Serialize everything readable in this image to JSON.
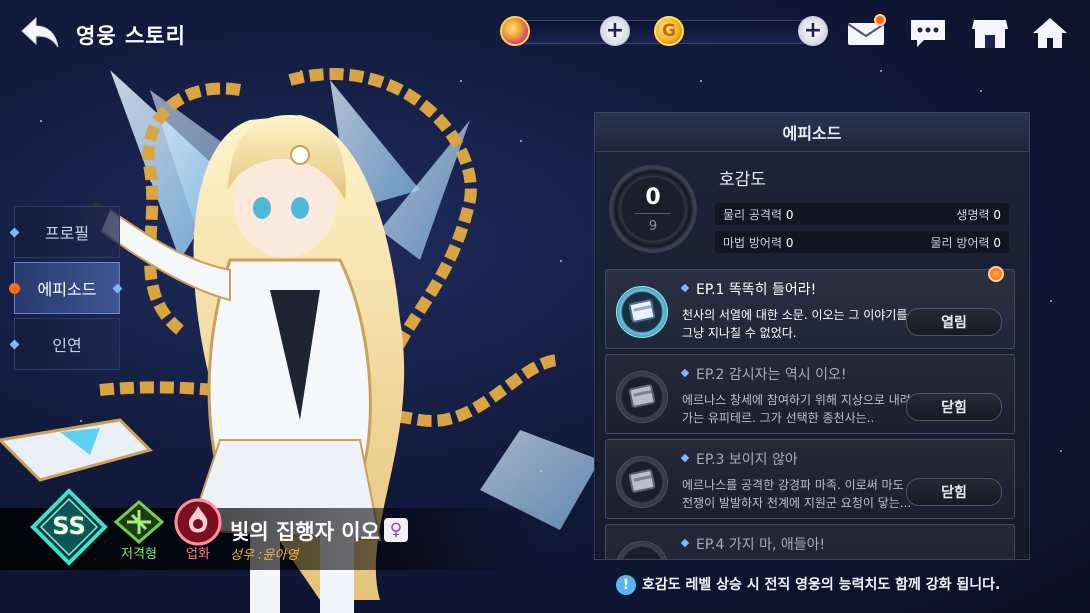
{
  "header": {
    "title": "영웅 스토리",
    "gold_symbol": "G"
  },
  "side_tabs": [
    {
      "label": "프로필",
      "active": false
    },
    {
      "label": "에피소드",
      "active": true
    },
    {
      "label": "인연",
      "active": false
    }
  ],
  "hero": {
    "rank": "SS",
    "class_label": "저격형",
    "element_label": "업화",
    "name": "빛의 집행자 이오",
    "gender_symbol": "♀",
    "cv": "성우 :윤아영"
  },
  "panel": {
    "title": "에피소드",
    "affinity": {
      "label": "호감도",
      "level": "0",
      "max": "9"
    },
    "stats": [
      {
        "label": "물리 공격력",
        "value": "0"
      },
      {
        "label": "생명력",
        "value": "0"
      },
      {
        "label": "마법 방어력",
        "value": "0"
      },
      {
        "label": "물리 방어력",
        "value": "0"
      }
    ],
    "episodes": [
      {
        "title": "EP.1 똑똑히 들어라!",
        "desc": "천사의 서열에 대한 소문. 이오는 그 이야기를 그냥 지나칠 수 없었다.",
        "button": "열림",
        "state": "open"
      },
      {
        "title": "EP.2 감시자는 역시 이오!",
        "desc": "에르나스 창세에 참여하기 위해 지상으로 내려가는 유피테르. 그가 선택한 종천사는..",
        "button": "닫힘",
        "state": "locked"
      },
      {
        "title": "EP.3 보이지 않아",
        "desc": "에르나스를 공격한 강경파 마족. 이로써 마도 전쟁이 발발하자 천계에 지원군 요청이 닿는...",
        "button": "닫힘",
        "state": "locked"
      },
      {
        "title": "EP.4 가지 마, 애들아!",
        "desc": "",
        "button": "",
        "state": "locked"
      }
    ]
  },
  "footer_note": "호감도 레벨 상승 시 전직 영웅의 능력치도 함께 강화 됩니다.",
  "colors": {
    "accent_blue": "#7db8ff",
    "notify_orange": "#ff6a1a",
    "class_green": "#8fe07a",
    "element_red": "#ff7b7b",
    "cv_gold": "#f4b33a"
  }
}
